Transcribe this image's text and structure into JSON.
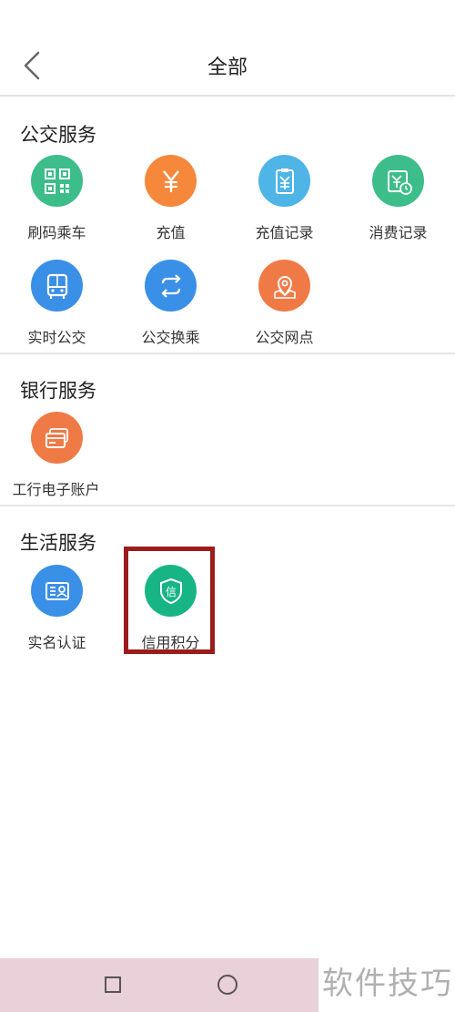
{
  "header": {
    "title": "全部"
  },
  "sections": {
    "bus": {
      "title": "公交服务",
      "items": [
        {
          "label": "刷码乘车",
          "icon": "qr-code-icon",
          "color": "#3dbd8a"
        },
        {
          "label": "充值",
          "icon": "yen-icon",
          "color": "#f5883a"
        },
        {
          "label": "充值记录",
          "icon": "recharge-record-icon",
          "color": "#4fb4e6"
        },
        {
          "label": "消费记录",
          "icon": "consume-record-icon",
          "color": "#3dbd8a"
        },
        {
          "label": "实时公交",
          "icon": "bus-icon",
          "color": "#3a8fe6"
        },
        {
          "label": "公交换乘",
          "icon": "transfer-icon",
          "color": "#3a8fe6"
        },
        {
          "label": "公交网点",
          "icon": "map-pin-icon",
          "color": "#f07a45"
        }
      ]
    },
    "bank": {
      "title": "银行服务",
      "items": [
        {
          "label": "工行电子账户",
          "icon": "bank-card-icon",
          "color": "#f07a45"
        }
      ]
    },
    "life": {
      "title": "生活服务",
      "items": [
        {
          "label": "实名认证",
          "icon": "id-card-icon",
          "color": "#3a8fe6"
        },
        {
          "label": "信用积分",
          "icon": "credit-shield-icon",
          "color": "#17b585",
          "glyph": "信"
        }
      ]
    }
  },
  "highlight_color": "#9c1b1b",
  "watermark": "软件技巧"
}
